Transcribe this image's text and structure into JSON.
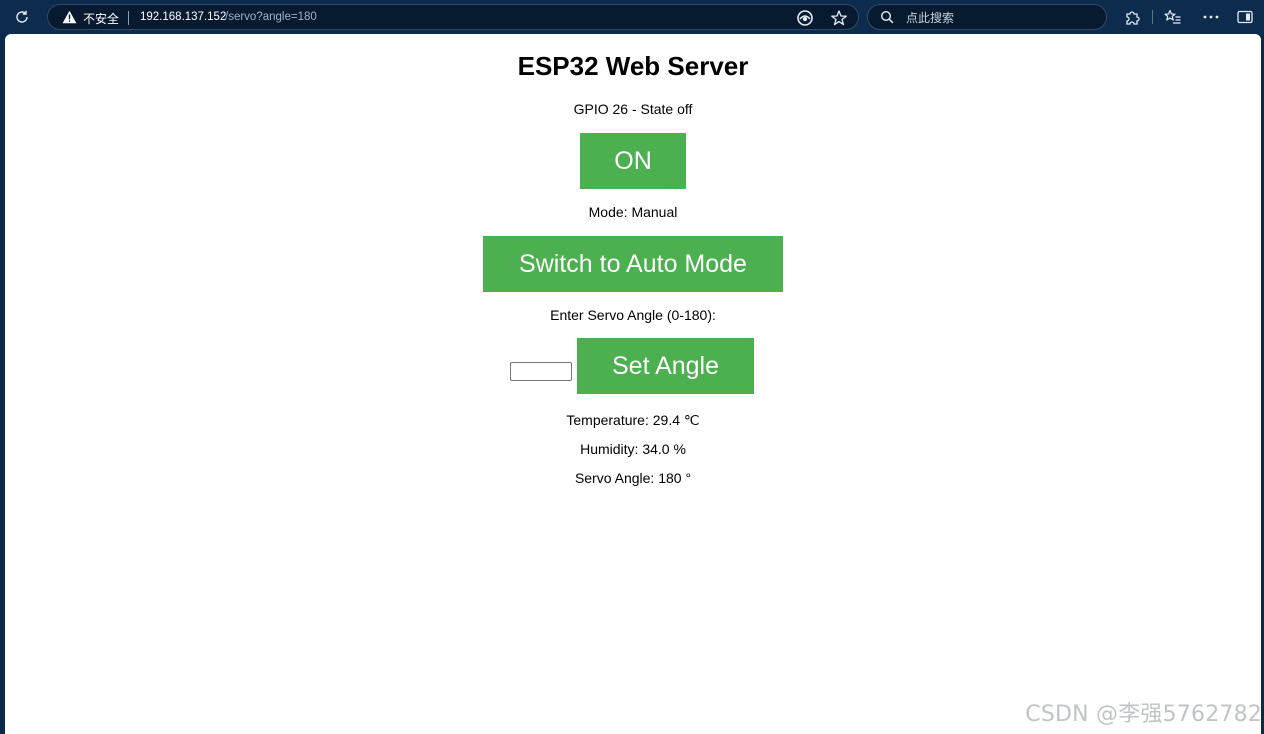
{
  "browser": {
    "security_label": "不安全",
    "url_host": "192.168.137.152",
    "url_path": "/servo?angle=180",
    "search_placeholder": "点此搜索"
  },
  "page": {
    "title": "ESP32 Web Server",
    "gpio_status": "GPIO 26 - State off",
    "on_button_label": "ON",
    "mode_text": "Mode: Manual",
    "mode_button_label": "Switch to Auto Mode",
    "servo_prompt": "Enter Servo Angle (0-180):",
    "angle_input_value": "",
    "set_angle_button_label": "Set Angle",
    "temperature_text": "Temperature: 29.4 ℃",
    "humidity_text": "Humidity: 34.0 %",
    "servo_angle_text": "Servo Angle: 180 °"
  },
  "watermark": "CSDN @李强5762782",
  "colors": {
    "button_green": "#4caf50",
    "chrome_bg": "#0d2b4c"
  }
}
